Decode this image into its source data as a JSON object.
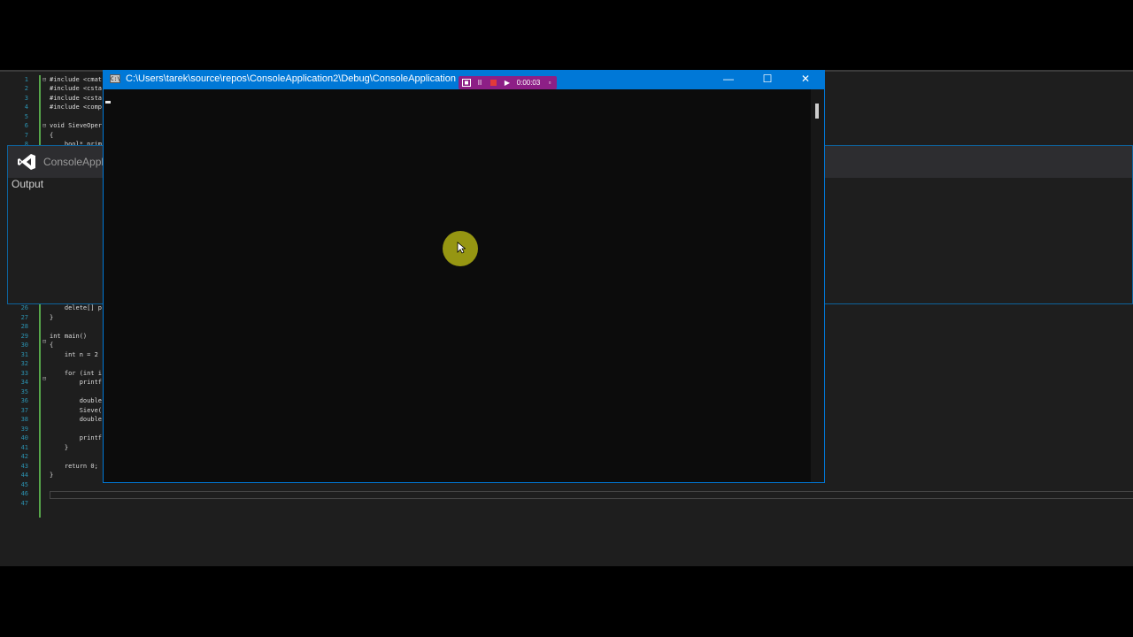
{
  "editor": {
    "line_numbers": [
      "1",
      "2",
      "3",
      "4",
      "5",
      "6",
      "7",
      "8",
      "26",
      "27",
      "28",
      "29",
      "30",
      "31",
      "32",
      "33",
      "34",
      "35",
      "36",
      "37",
      "38",
      "39",
      "40",
      "41",
      "42",
      "43",
      "44",
      "45",
      "46",
      "47"
    ],
    "code_lines": [
      "#include <cmat",
      "#include <csta",
      "#include <csta",
      "#include <comp",
      "",
      "void SieveOper",
      "{",
      "    bool* prim",
      "    delete[] p",
      "}",
      "",
      "int main()",
      "{",
      "    int n = 2",
      "",
      "    for (int i",
      "        printf",
      "",
      "        double",
      "        Sieve(",
      "        double",
      "",
      "        printf",
      "    }",
      "",
      "    return 0;",
      "}",
      "",
      "",
      ""
    ]
  },
  "output_pane": {
    "app_title": "ConsoleAppli",
    "output_label": "Output"
  },
  "console": {
    "title": "C:\\Users\\tarek\\source\\repos\\ConsoleApplication2\\Debug\\ConsoleApplication",
    "icon_text": "C:\\",
    "minimize": "—",
    "maximize": "☐",
    "close": "✕"
  },
  "recorder": {
    "time": "0:00:03",
    "pause": "II",
    "play": "▶",
    "close": "▫"
  }
}
